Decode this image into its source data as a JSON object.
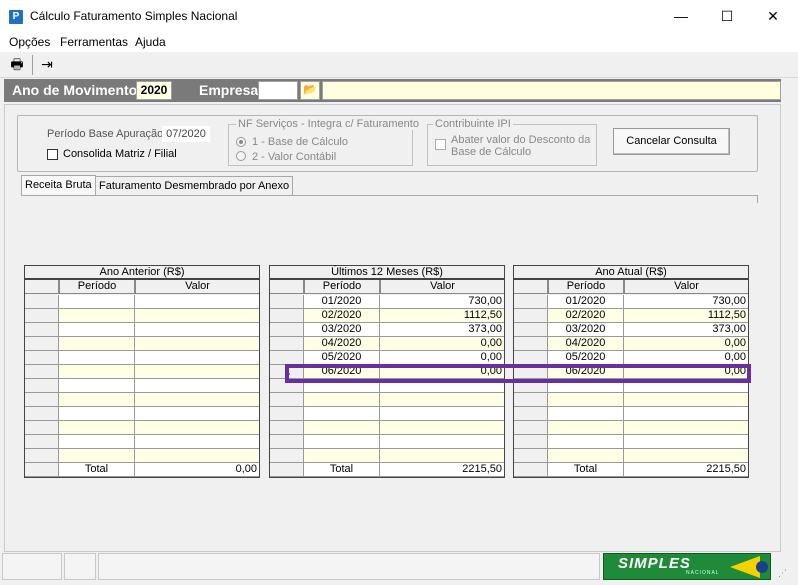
{
  "window": {
    "title": "Cálculo Faturamento Simples Nacional",
    "minimize": "—",
    "maximize": "☐",
    "close": "✕",
    "icon_letter": "P"
  },
  "menu": [
    "Opções",
    "Ferramentas",
    "Ajuda"
  ],
  "toolbar": {
    "print_icon": "🖶",
    "exit_icon": "⇥"
  },
  "header": {
    "ano_label": "Ano de Movimento",
    "ano_value": "2020",
    "empresa_label": "Empresa",
    "empresa_code": "",
    "empresa_name": "",
    "folder_icon": "📂"
  },
  "filters": {
    "periodo_label": "Período Base Apuração:",
    "periodo_value": "07/2020",
    "consolida_label": "Consolida Matriz / Filial",
    "nf_group_title": "NF Serviços - Integra c/ Faturamento",
    "nf_option1": "1 - Base de Cálculo",
    "nf_option2": "2 - Valor Contábil",
    "ipi_group_title": "Contribuinte IPI",
    "ipi_check_label": "Abater valor do Desconto da Base de Cálculo",
    "cancel_button": "Cancelar Consulta"
  },
  "tabs": [
    "Receita Bruta",
    "Faturamento Desmembrado por Anexo"
  ],
  "grids": [
    {
      "title": "Ano Anterior (R$)",
      "col_periodo": "Período",
      "col_valor": "Valor",
      "rows": [
        [
          "",
          ""
        ],
        [
          "",
          ""
        ],
        [
          "",
          ""
        ],
        [
          "",
          ""
        ],
        [
          "",
          ""
        ],
        [
          "",
          ""
        ],
        [
          "",
          ""
        ],
        [
          "",
          ""
        ],
        [
          "",
          ""
        ],
        [
          "",
          ""
        ],
        [
          "",
          ""
        ],
        [
          "",
          ""
        ]
      ],
      "total_label": "Total",
      "total_value": "0,00"
    },
    {
      "title": "Últimos 12 Meses (R$)",
      "col_periodo": "Período",
      "col_valor": "Valor",
      "rows": [
        [
          "01/2020",
          "730,00"
        ],
        [
          "02/2020",
          "1112,50"
        ],
        [
          "03/2020",
          "373,00"
        ],
        [
          "04/2020",
          "0,00"
        ],
        [
          "05/2020",
          "0,00"
        ],
        [
          "06/2020",
          "0,00"
        ],
        [
          "",
          ""
        ],
        [
          "",
          ""
        ],
        [
          "",
          ""
        ],
        [
          "",
          ""
        ],
        [
          "",
          ""
        ],
        [
          "",
          ""
        ]
      ],
      "total_label": "Total",
      "total_value": "2215,50"
    },
    {
      "title": "Ano Atual (R$)",
      "col_periodo": "Período",
      "col_valor": "Valor",
      "rows": [
        [
          "01/2020",
          "730,00"
        ],
        [
          "02/2020",
          "1112,50"
        ],
        [
          "03/2020",
          "373,00"
        ],
        [
          "04/2020",
          "0,00"
        ],
        [
          "05/2020",
          "0,00"
        ],
        [
          "06/2020",
          "0,00"
        ],
        [
          "",
          ""
        ],
        [
          "",
          ""
        ],
        [
          "",
          ""
        ],
        [
          "",
          ""
        ],
        [
          "",
          ""
        ],
        [
          "",
          ""
        ]
      ],
      "total_label": "Total",
      "total_value": "2215,50"
    }
  ],
  "selected_row": 5,
  "status": {
    "logo_text": "SIMPLES",
    "logo_sub": "NACIONAL"
  },
  "colors": {
    "header_band": "#7a7a7a",
    "row_yellow": "#ffffe6",
    "selection": "#6a2ea0",
    "logo_green": "#1f8a3a"
  }
}
